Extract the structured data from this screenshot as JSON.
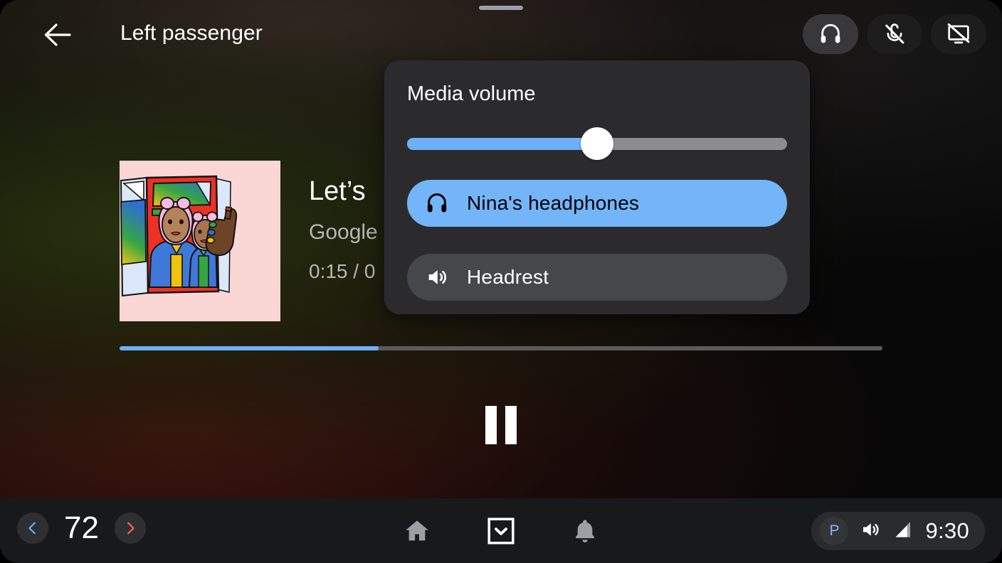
{
  "header": {
    "title": "Left passenger",
    "back_icon": "arrow-left-icon",
    "actions": [
      {
        "name": "headphones-toggle",
        "icon": "headphones-icon",
        "active": true
      },
      {
        "name": "mic-off-toggle",
        "icon": "microphone-off-icon",
        "active": false
      },
      {
        "name": "screen-off-toggle",
        "icon": "screen-off-icon",
        "active": false
      }
    ]
  },
  "media": {
    "track_title": "Let’s",
    "artist": "Google",
    "time": "0:15 / 0",
    "progress_percent": 34,
    "album_art_alt": "album-artwork",
    "transport": {
      "pause_label": "Pause",
      "icon": "pause-icon"
    }
  },
  "volume_panel": {
    "title": "Media volume",
    "slider": {
      "name": "media-volume-slider",
      "value": 50,
      "min": 0,
      "max": 100
    },
    "outputs": [
      {
        "label": "Nina's headphones",
        "icon": "headphones-icon",
        "selected": true
      },
      {
        "label": "Headrest",
        "icon": "speaker-icon",
        "selected": false
      }
    ]
  },
  "system_bar": {
    "temperature": {
      "value": "72",
      "decrease_icon": "chevron-left-icon",
      "increase_icon": "chevron-right-icon"
    },
    "nav": [
      {
        "name": "home-button",
        "icon": "home-icon"
      },
      {
        "name": "app-grid-button",
        "icon": "chevron-down-boxed-icon"
      },
      {
        "name": "notifications-button",
        "icon": "bell-icon"
      }
    ],
    "status": {
      "profile_badge": "P",
      "volume_icon": "speaker-icon",
      "signal_icon": "signal-bars-icon",
      "time": "9:30"
    }
  },
  "colors": {
    "accent_blue": "#6db0f7",
    "pill_blue": "#74b4f8",
    "panel_bg": "#2b2b2d",
    "sysbar_bg": "#18191b",
    "temp_cool": "#5aa9f0",
    "temp_warm": "#e8634a"
  }
}
